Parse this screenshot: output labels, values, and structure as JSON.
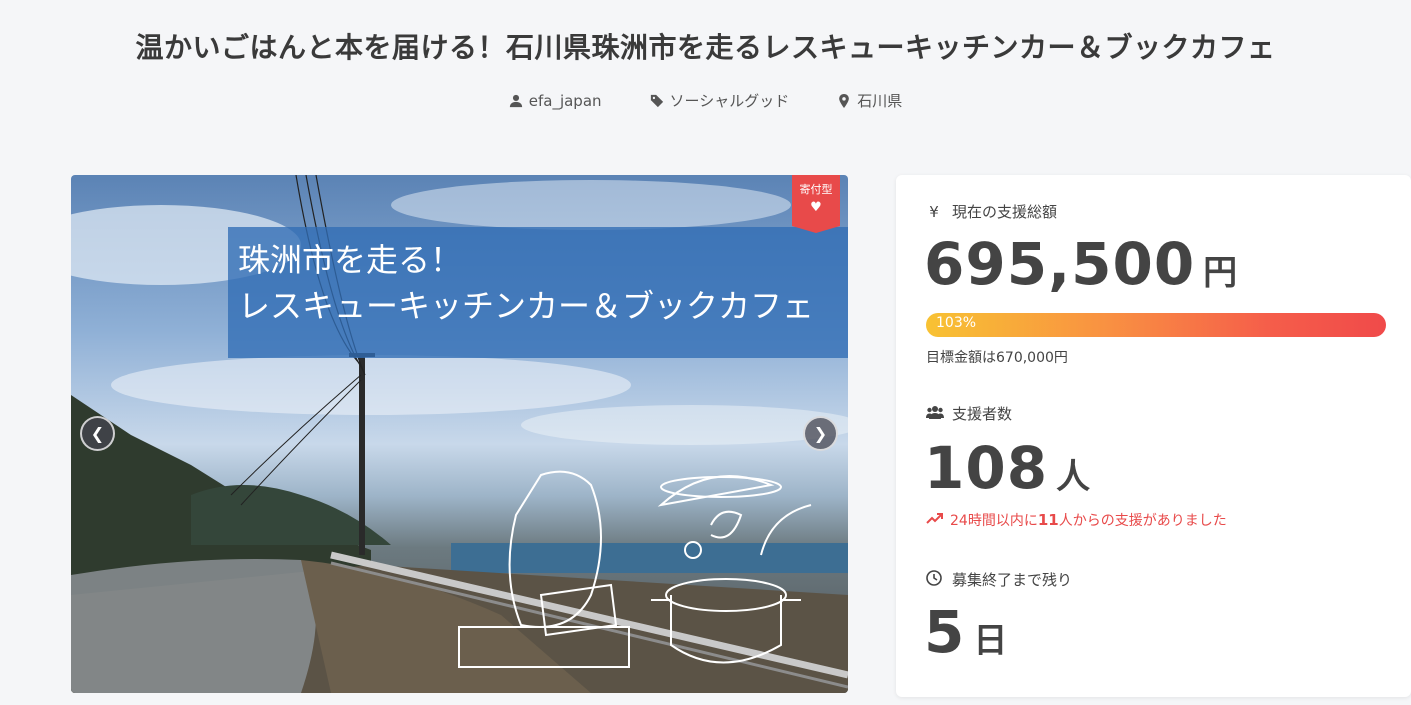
{
  "project": {
    "title": "温かいごはんと本を届ける！石川県珠洲市を走るレスキューキッチンカー＆ブックカフェ",
    "owner": "efa_japan",
    "category": "ソーシャルグッド",
    "location": "石川県"
  },
  "hero": {
    "overlay_line1": "珠洲市を走る！",
    "overlay_line2": "レスキューキッチンカー＆ブックカフェ",
    "badge_label": "寄付型",
    "prev_icon": "chevron-left-icon",
    "next_icon": "chevron-right-icon"
  },
  "stats": {
    "amount_label": "現在の支援総額",
    "amount_value": "695,500",
    "amount_unit": "円",
    "progress_percent": 103,
    "progress_label": "103%",
    "goal_text": "目標金額は670,000円",
    "supporters_label": "支援者数",
    "supporters_value": "108",
    "supporters_unit": "人",
    "recent_prefix": "24時間以内に",
    "recent_count": "11",
    "recent_suffix": "人からの支援がありました",
    "remaining_label": "募集終了まで残り",
    "remaining_value": "5",
    "remaining_unit": "日"
  },
  "colors": {
    "accent_red": "#e84a4a",
    "progress_start": "#f8c233",
    "progress_end": "#f04a4a",
    "overlay_blue": "#316db5"
  }
}
